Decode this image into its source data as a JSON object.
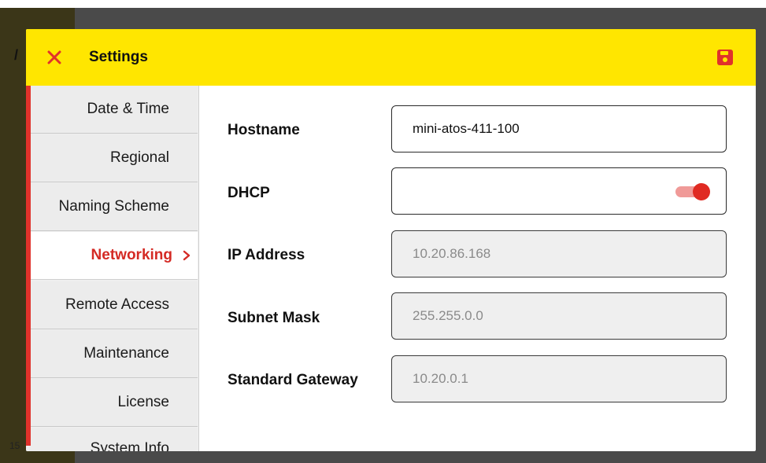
{
  "backdrop": {
    "mark": "/",
    "number": "15"
  },
  "header": {
    "title": "Settings",
    "accent_color": "#ffe600",
    "close_icon": "close-icon",
    "save_icon": "floppy-save-icon"
  },
  "sidebar": {
    "items": [
      {
        "label": "Date & Time"
      },
      {
        "label": "Regional"
      },
      {
        "label": "Naming Scheme"
      },
      {
        "label": "Networking",
        "active": true
      },
      {
        "label": "Remote Access"
      },
      {
        "label": "Maintenance"
      },
      {
        "label": "License"
      },
      {
        "label": "System Info"
      }
    ],
    "accent_color": "#e0322b"
  },
  "form": {
    "hostname": {
      "label": "Hostname",
      "value": "mini-atos-411-100"
    },
    "dhcp": {
      "label": "DHCP",
      "enabled": true
    },
    "ip_address": {
      "label": "IP Address",
      "value": "10.20.86.168"
    },
    "subnet_mask": {
      "label": "Subnet Mask",
      "value": "255.255.0.0"
    },
    "standard_gateway": {
      "label": "Standard Gateway",
      "value": "10.20.0.1"
    }
  }
}
